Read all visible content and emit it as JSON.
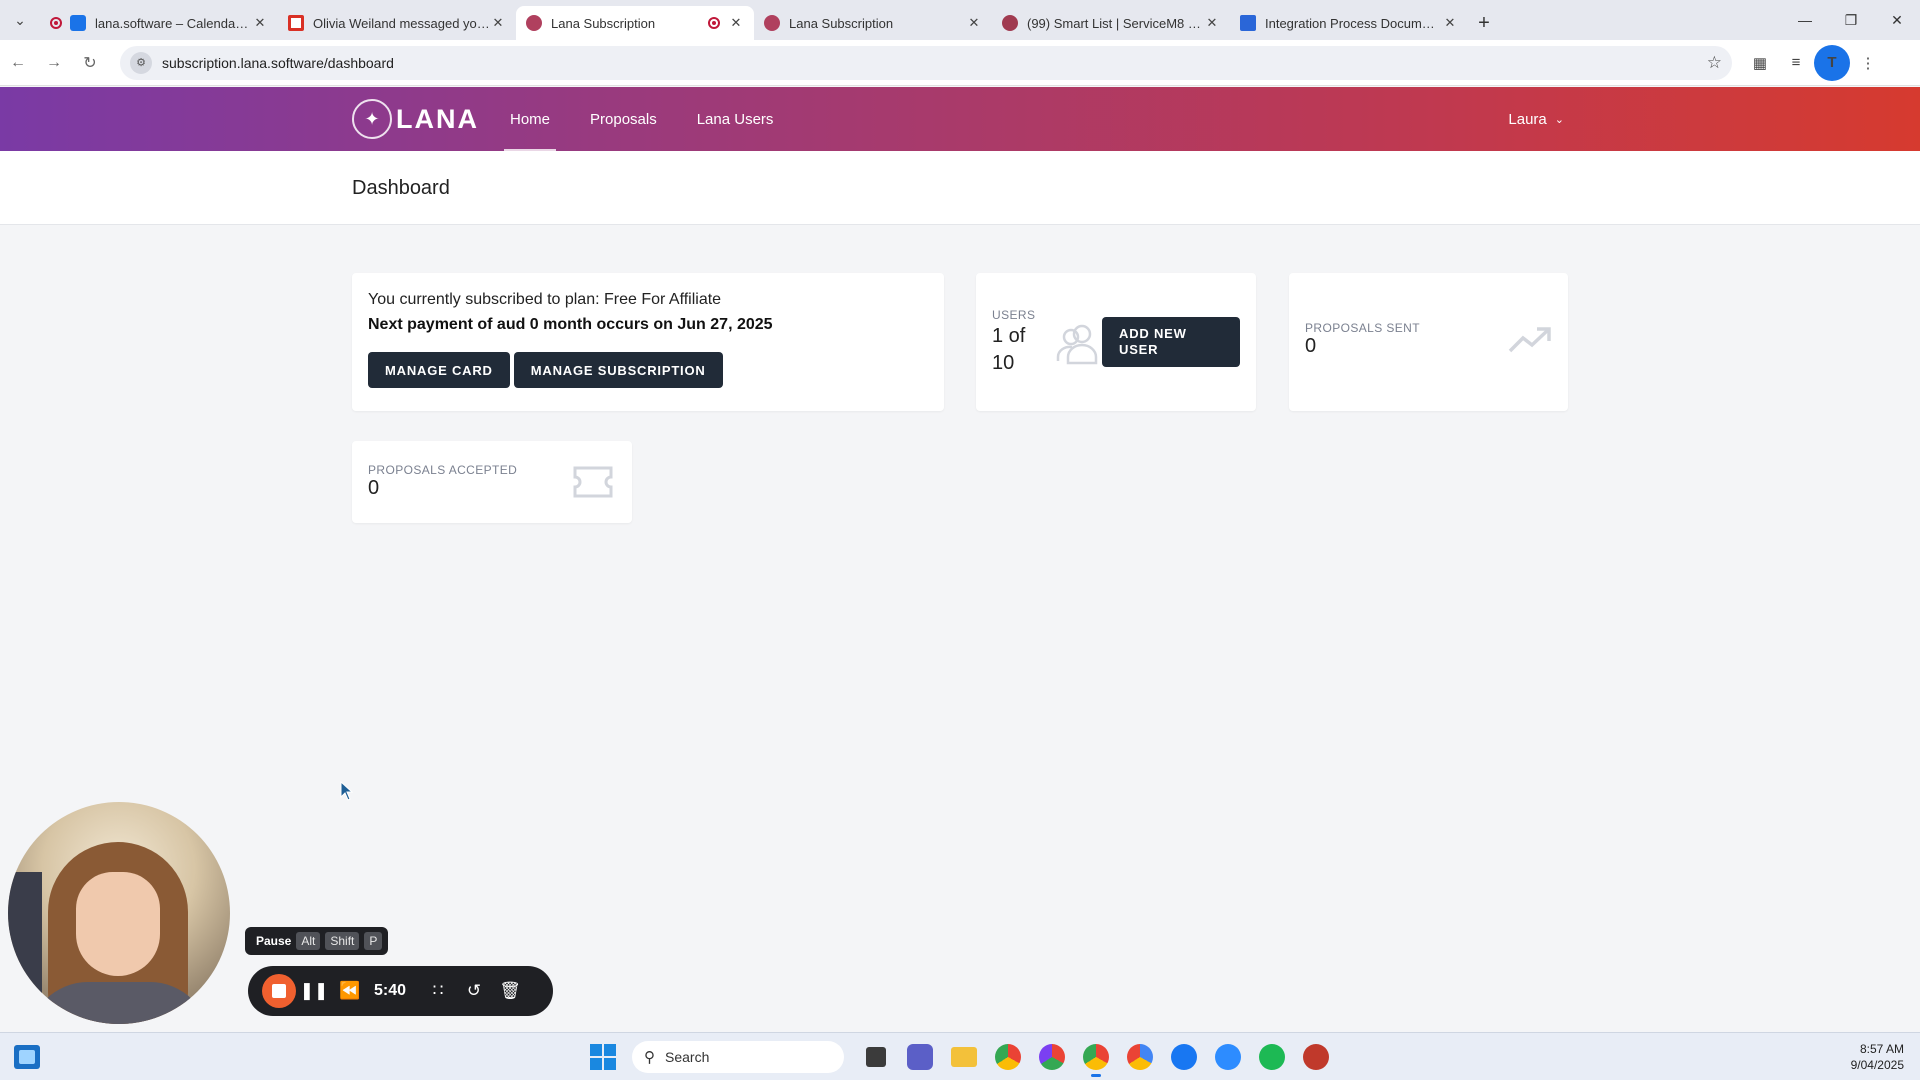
{
  "browser": {
    "tabs": [
      {
        "title": "lana.software – Calendar - Wed",
        "favicon_color": "#1a73e8",
        "active": false,
        "recording": true
      },
      {
        "title": "Olivia Weiland messaged you -",
        "favicon_color": "#d93025",
        "active": false,
        "recording": false
      },
      {
        "title": "Lana Subscription",
        "favicon_color": "#b0405e",
        "active": true,
        "recording": true
      },
      {
        "title": "Lana Subscription",
        "favicon_color": "#b0405e",
        "active": false,
        "recording": false
      },
      {
        "title": "(99) Smart List | ServiceM8 V2 D",
        "favicon_color": "#a03a50",
        "active": false,
        "recording": false
      },
      {
        "title": "Integration Process Documenta",
        "favicon_color": "#2a66d8",
        "active": false,
        "recording": false
      }
    ],
    "url": "subscription.lana.software/dashboard",
    "profile_initial": "T"
  },
  "app": {
    "logo_text": "LANA",
    "nav": {
      "home": "Home",
      "proposals": "Proposals",
      "lana_users": "Lana Users"
    },
    "user_name": "Laura",
    "page_title": "Dashboard"
  },
  "plan": {
    "subscribed_text": "You currently subscribed to plan: Free For Affiliate",
    "next_payment_text": "Next payment of aud 0 month occurs on Jun 27, 2025",
    "manage_card_label": "MANAGE CARD",
    "manage_subscription_label": "MANAGE SUBSCRIPTION"
  },
  "users_stat": {
    "label": "USERS",
    "value": "1 of 10",
    "add_button_label": "ADD NEW USER"
  },
  "proposals_sent": {
    "label": "PROPOSALS SENT",
    "value": "0"
  },
  "proposals_accepted": {
    "label": "PROPOSALS ACCEPTED",
    "value": "0"
  },
  "recorder": {
    "hint_label": "Pause",
    "hint_keys": [
      "Alt",
      "Shift",
      "P"
    ],
    "elapsed": "5:40"
  },
  "taskbar": {
    "search_placeholder": "Search",
    "time": "8:57 AM",
    "date": "9/04/2025"
  },
  "colors": {
    "nav_gradient_start": "#7a3aa5",
    "nav_gradient_end": "#d63a2f",
    "dark_button": "#212b38",
    "record_button": "#f0602f"
  }
}
